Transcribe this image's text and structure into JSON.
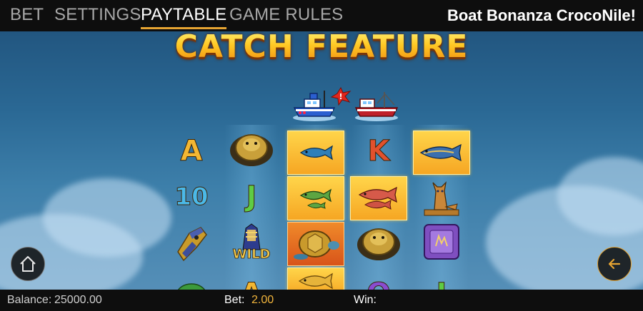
{
  "nav": {
    "tabs": [
      "BET",
      "SETTINGS",
      "PAYTABLE",
      "GAME RULES"
    ],
    "active_tab": "PAYTABLE",
    "game_title": "Boat Bonanza CrocoNile!"
  },
  "feature": {
    "title": "CATCH FEATURE"
  },
  "reels": {
    "col1": {
      "sym1": "A",
      "sym2": "10"
    },
    "col2": {
      "sym1": "scarab-icon",
      "sym2": "J",
      "wild_label": "WILD",
      "sym4": "A"
    },
    "col3": {
      "sym1": "fish-icon",
      "sym2": "fish-icon",
      "sym3": "turtle-icon",
      "sym4": "fish-icon"
    },
    "col4": {
      "sym1": "K",
      "sym2": "fish-icon",
      "sym3": "scarab-icon",
      "sym4": "Q"
    },
    "col5": {
      "sym1": "fish-icon",
      "sym2": "cat-statue-icon",
      "sym3": "tablet-icon",
      "sym4": "J"
    }
  },
  "colors": {
    "accent": "#e6a432",
    "highlight_cell": "#f6a623",
    "bar_bg": "#0e0e0e"
  },
  "status": {
    "balance_label": "Balance:",
    "balance_value": "25000.00",
    "bet_label": "Bet:",
    "bet_value": "2.00",
    "win_label": "Win:",
    "win_value": ""
  }
}
